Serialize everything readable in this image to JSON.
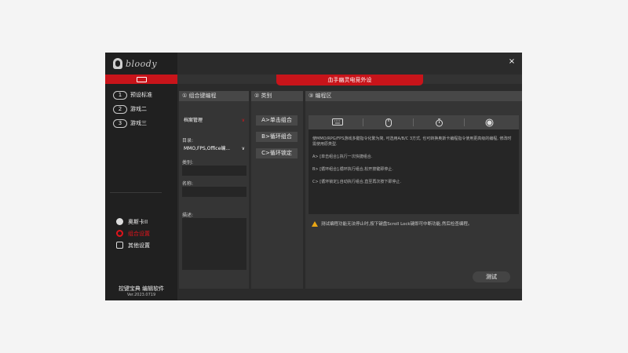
{
  "app": {
    "brand": "bloody",
    "title": "血手幽灵电竞外设",
    "close_label": "×"
  },
  "sidebar": {
    "modes": [
      {
        "num": "1",
        "label": "预设标准"
      },
      {
        "num": "2",
        "label": "游戏二"
      },
      {
        "num": "3",
        "label": "游戏三"
      }
    ],
    "links": [
      {
        "label": "奥斯卡II",
        "icon": "user-icon"
      },
      {
        "label": "组合设置",
        "icon": "gear-icon"
      },
      {
        "label": "其他设置",
        "icon": "settings-square-icon"
      }
    ],
    "footer_title": "控键宝典 编辑软件",
    "version": "Ver.2023.0719"
  },
  "combo_panel": {
    "header": "① 组合键编程",
    "file_select": "档案管理",
    "dir_label": "目录:",
    "dir_value": "MMO,FPS,Office编...",
    "category_label": "类别:",
    "name_label": "名称:",
    "desc_label": "描述:"
  },
  "category_panel": {
    "header": "② 类别",
    "buttons": [
      "A>单击组合",
      "B>循环组合",
      "C>循环锁定"
    ]
  },
  "edit_panel": {
    "header": "③ 编程区",
    "intro": "使MMO/RPG/FPS游戏多键指令化繁为简, 可选用A/B/C 3方式, 也可转换奥斯卡编程指令使用更高级的编程, 修改时需使用原类型.",
    "line_a": "A> [单击组合],执行一次快捷组合.",
    "line_b": "B> [循环组合],循环执行组合,松开按键即停止.",
    "line_c": "C> [循环锁定],自动执行组合,直至再次按下即停止.",
    "warning": "测试编程功能无法停止时,按下键盘Scroll Lock键即可中断功能,然后检查编程。",
    "test_button": "测试"
  },
  "colors": {
    "accent": "#c8141a",
    "warning": "#e8a514"
  }
}
